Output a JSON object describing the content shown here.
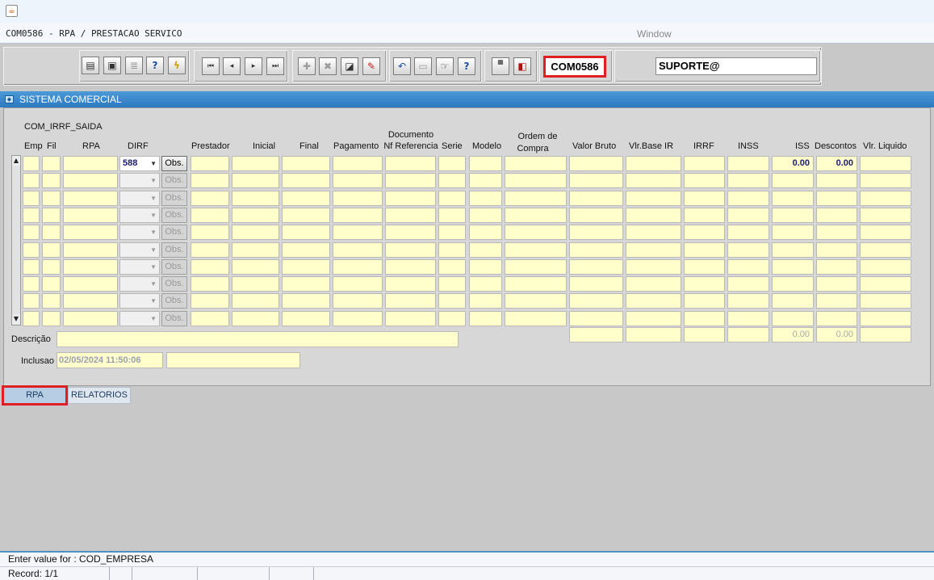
{
  "window": {
    "title": "COM0586 - RPA / PRESTACAO SERVICO",
    "label": "Window"
  },
  "toolbar": {
    "form_code": "COM0586",
    "user": "SUPORTE@",
    "icons": [
      "save-icon",
      "print-setup-icon",
      "print-icon",
      "query-help-icon",
      "execute-query-icon",
      "first-record-icon",
      "previous-record-icon",
      "next-record-icon",
      "last-record-icon",
      "insert-record-icon",
      "delete-record-icon",
      "list-values-icon",
      "edit-icon",
      "undo-icon",
      "clear-icon",
      "key-help-icon",
      "help-icon",
      "menu-icon",
      "exit-icon"
    ]
  },
  "panel": {
    "title": "SISTEMA COMERCIAL"
  },
  "block": {
    "name": "COM_IRRF_SAIDA",
    "headers": {
      "emp": "Emp",
      "fil": "Fil",
      "rpa": "RPA",
      "dirf": "DIRF",
      "prestador": "Prestador",
      "inicial": "Inicial",
      "final": "Final",
      "pagamento": "Pagamento",
      "documento1": "Documento",
      "documento2": "Nf Referencia",
      "serie": "Serie",
      "modelo": "Modelo",
      "ordem1": "Ordem de",
      "ordem2": "Compra",
      "valor_bruto": "Valor Bruto",
      "vlr_base_ir": "Vlr.Base IR",
      "irrf": "IRRF",
      "inss": "INSS",
      "iss": "ISS",
      "descontos": "Descontos",
      "vlr_liquido": "Vlr. Liquido"
    },
    "row_count": 10,
    "rows": [
      {
        "dirf": "588",
        "iss": "0.00",
        "descontos": "0.00"
      }
    ],
    "obs_label": "Obs.",
    "totals": {
      "iss": "0.00",
      "descontos": "0.00"
    },
    "descricao_label": "Descrição",
    "inclusao_label": "Inclusao",
    "inclusao_value": "02/05/2024 11:50:06"
  },
  "tabs": [
    {
      "label": "RPA",
      "active": true
    },
    {
      "label": "RELATORIOS",
      "active": false
    }
  ],
  "status": {
    "message": "Enter value for : COD_EMPRESA",
    "record": "Record: 1/1"
  }
}
